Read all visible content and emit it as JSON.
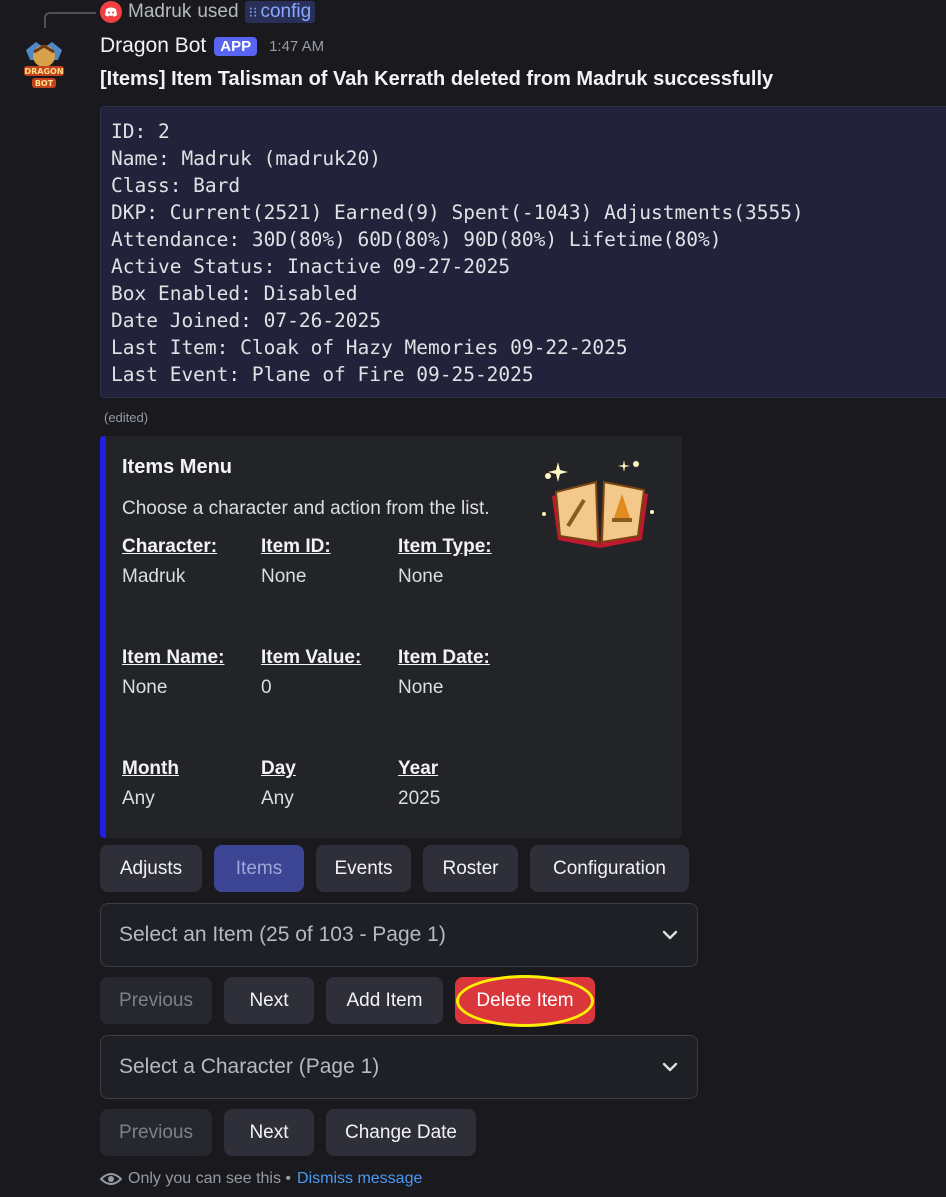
{
  "reply": {
    "user": "Madruk",
    "verb": "used",
    "command": "config"
  },
  "message": {
    "bot_name": "Dragon Bot",
    "badge": "APP",
    "time": "1:47 AM",
    "title": "[Items] Item Talisman of Vah Kerrath deleted from Madruk successfully",
    "code_lines": [
      "ID: 2",
      "Name: Madruk (madruk20)",
      "Class: Bard",
      "DKP: Current(2521) Earned(9) Spent(-1043) Adjustments(3555)",
      "Attendance: 30D(80%) 60D(80%) 90D(80%) Lifetime(80%)",
      "Active Status: Inactive 09-27-2025",
      "Box Enabled: Disabled",
      "Date Joined: 07-26-2025",
      "Last Item: Cloak of Hazy Memories 09-22-2025",
      "Last Event: Plane of Fire 09-25-2025"
    ],
    "edited_label": "(edited)"
  },
  "embed": {
    "title": "Items Menu",
    "description": "Choose a character and action from the list.",
    "accent_color": "#1f1fe8",
    "thumbnail_icon": "magic-book-icon",
    "fields": [
      {
        "name": "Character:",
        "value": "Madruk"
      },
      {
        "name": "Item ID:",
        "value": "None"
      },
      {
        "name": "Item Type:",
        "value": "None"
      },
      {
        "name": "Item Name:",
        "value": "None"
      },
      {
        "name": "Item Value:",
        "value": "0"
      },
      {
        "name": "Item Date:",
        "value": "None"
      },
      {
        "name": "Month",
        "value": "Any"
      },
      {
        "name": "Day",
        "value": "Any"
      },
      {
        "name": "Year",
        "value": "2025"
      }
    ]
  },
  "menu_buttons": [
    "Adjusts",
    "Items",
    "Events",
    "Roster",
    "Configuration"
  ],
  "item_select": {
    "placeholder": "Select an Item (25 of 103 - Page 1)"
  },
  "item_buttons": {
    "previous": "Previous",
    "next": "Next",
    "add": "Add Item",
    "delete": "Delete Item"
  },
  "character_select": {
    "placeholder": "Select a Character (Page 1)"
  },
  "character_buttons": {
    "previous": "Previous",
    "next": "Next",
    "change_date": "Change Date"
  },
  "footer": {
    "note": "Only you can see this •",
    "dismiss": "Dismiss message"
  },
  "colors": {
    "danger": "#da373c",
    "brand": "#5865f2",
    "highlight": "#ffef00"
  }
}
